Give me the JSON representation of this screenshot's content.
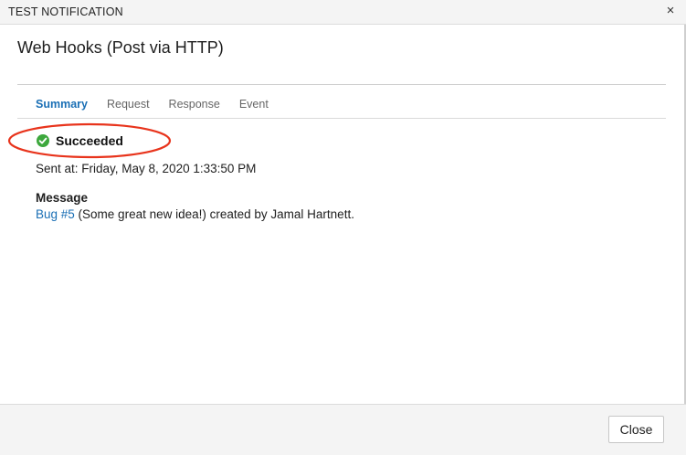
{
  "window": {
    "title": "TEST NOTIFICATION",
    "close_glyph": "×",
    "close_icon": "close-icon"
  },
  "header": {
    "title": "Web Hooks (Post via HTTP)"
  },
  "tabs": [
    {
      "label": "Summary",
      "active": true
    },
    {
      "label": "Request",
      "active": false
    },
    {
      "label": "Response",
      "active": false
    },
    {
      "label": "Event",
      "active": false
    }
  ],
  "summary": {
    "status": {
      "label": "Succeeded",
      "icon": "check-circle-icon",
      "color": "#3da83d"
    },
    "sent_at": "Sent at: Friday, May 8, 2020 1:33:50 PM",
    "message": {
      "heading": "Message",
      "link_text": "Bug #5",
      "text": " (Some great new idea!) created by Jamal Hartnett."
    }
  },
  "annotation": {
    "color": "#e8341c"
  },
  "colors": {
    "accent": "#1a6fb5",
    "text": "#1e1e1e"
  },
  "footer": {
    "close_label": "Close"
  }
}
